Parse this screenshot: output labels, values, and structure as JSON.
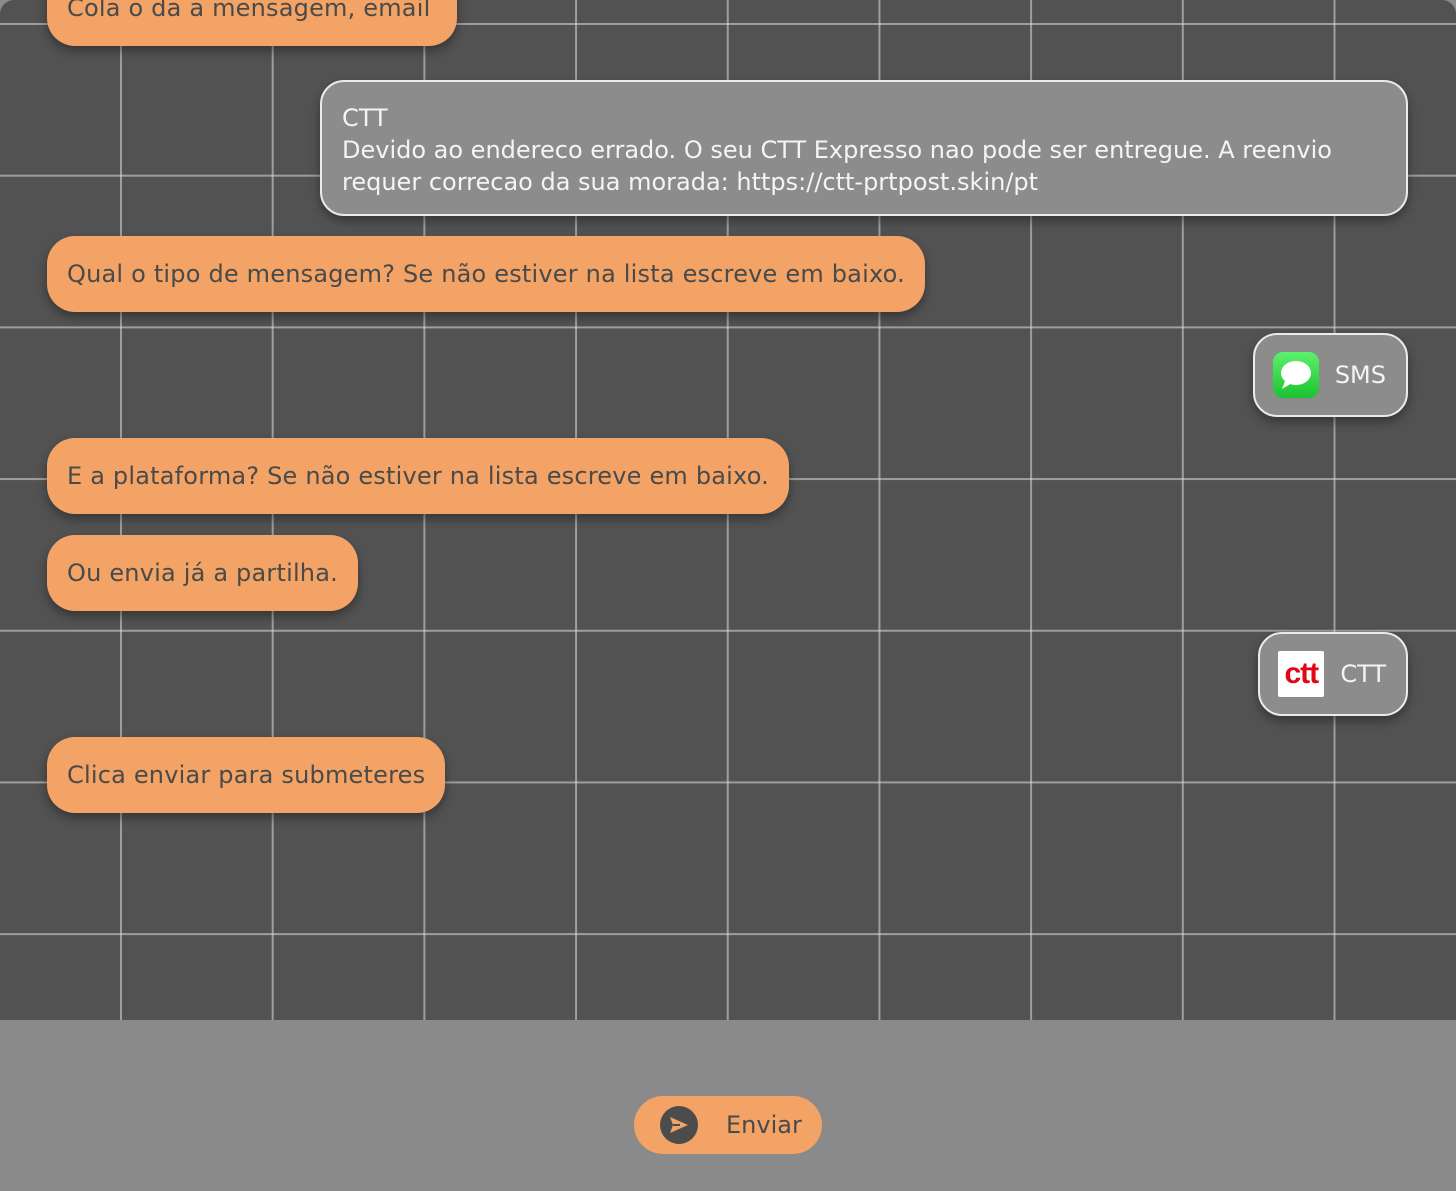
{
  "chat": {
    "partial_bot_message": "Cola o  da a mensagem, email",
    "user_message": {
      "sender": "CTT",
      "body": "Devido ao endereco errado. O seu CTT Expresso nao pode ser entregue. A reenvio requer correcao da sua morada: https://ctt-prtpost.skin/pt"
    },
    "bot_type_question": "Qual o tipo de mensagem? Se não estiver na lista escreve em baixo.",
    "type_choice": {
      "label": "SMS",
      "icon": "message-bubble-icon",
      "icon_color": "#1ac331"
    },
    "bot_platform_question": "E a plataforma? Se não estiver na lista escreve em baixo.",
    "bot_share_hint": "Ou envia já a partilha.",
    "platform_choice": {
      "label": "CTT",
      "logo_text": "ctt",
      "logo_color": "#e30613"
    },
    "bot_submit_hint": "Clica enviar para submeteres"
  },
  "footer": {
    "send_label": "Enviar",
    "send_icon": "send-arrow-icon"
  },
  "colors": {
    "bot_bubble": "#f2a365",
    "user_bubble": "#8c8c8c",
    "background": "#525252"
  }
}
